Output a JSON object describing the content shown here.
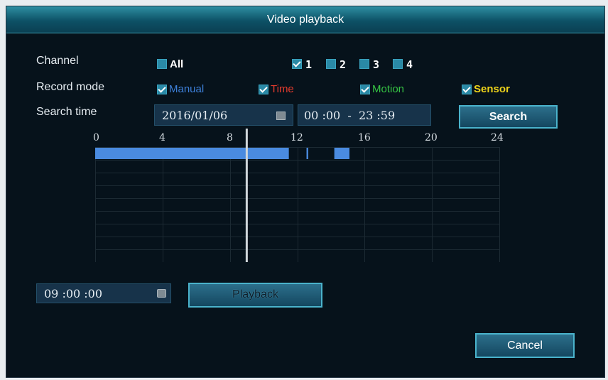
{
  "window": {
    "title": "Video playback"
  },
  "channel": {
    "label": "Channel",
    "all_label": "All",
    "options": [
      "1",
      "2",
      "3",
      "4"
    ],
    "checked": [
      true,
      false,
      false,
      false
    ]
  },
  "record_mode": {
    "label": "Record mode",
    "modes": [
      {
        "label": "Manual",
        "color": "#3d7fd8",
        "checked": true
      },
      {
        "label": "Time",
        "color": "#e33b2d",
        "checked": true
      },
      {
        "label": "Motion",
        "color": "#36c444",
        "checked": true
      },
      {
        "label": "Sensor",
        "color": "#ecd21a",
        "checked": true
      }
    ]
  },
  "search_time": {
    "label": "Search time",
    "date": "2016/01/06",
    "time_range": "00 :00  -  23 :59",
    "search_label": "Search"
  },
  "timeline": {
    "hour_ticks": [
      "0",
      "4",
      "8",
      "12",
      "16",
      "20",
      "24"
    ],
    "range_hours": [
      0,
      24
    ],
    "recordings": [
      {
        "start": 0,
        "end": 11.5
      },
      {
        "start": 12.55,
        "end": 12.65
      },
      {
        "start": 14.2,
        "end": 15.1
      }
    ],
    "cursor_hour": 9,
    "recording_color": "#4a8be0"
  },
  "playback": {
    "time": "09 :00 :00",
    "button_label": "Playback"
  },
  "footer": {
    "cancel_label": "Cancel"
  }
}
